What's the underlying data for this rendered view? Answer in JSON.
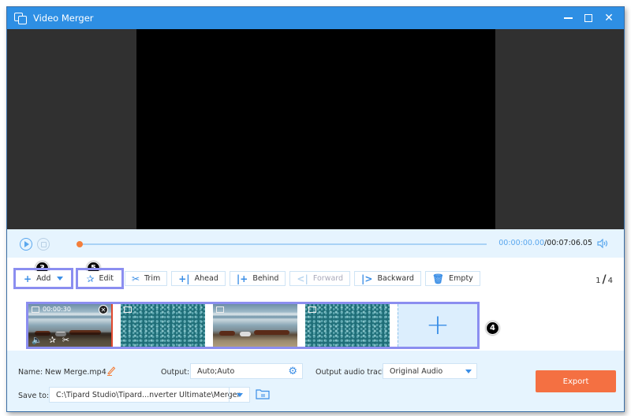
{
  "window": {
    "title": "Video Merger",
    "controls": {
      "minimize": "minimize",
      "maximize": "maximize",
      "close": "✕"
    }
  },
  "player": {
    "current_time": "00:00:00.00",
    "total_time": "/00:07:06.05",
    "progress_fraction": 0.0
  },
  "toolbar": {
    "add_label": "Add",
    "edit_label": "Edit",
    "trim_label": "Trim",
    "ahead_label": "Ahead",
    "behind_label": "Behind",
    "forward_label": "Forward",
    "backward_label": "Backward",
    "empty_label": "Empty",
    "icons": {
      "add": "+",
      "edit": "✰",
      "trim": "✂",
      "ahead": "+|",
      "behind": "|+",
      "forward": "<|",
      "backward": "|>",
      "empty": "🗑"
    }
  },
  "page_indicator": {
    "current": "1",
    "separator": "/",
    "total": "4"
  },
  "annotations": {
    "add": "3",
    "edit": "5",
    "clips": "4"
  },
  "clips": [
    {
      "type": "beach",
      "duration": "00:00:30",
      "selected": true
    },
    {
      "type": "noise",
      "duration": "",
      "selected": false
    },
    {
      "type": "beach",
      "duration": "",
      "selected": false
    },
    {
      "type": "noise",
      "duration": "",
      "selected": false
    }
  ],
  "add_slot_label": "+",
  "output": {
    "name_label": "Name:",
    "name_value": "New Merge.mp4",
    "output_label": "Output:",
    "output_value": "Auto;Auto",
    "audio_label": "Output audio track:",
    "audio_value": "Original Audio",
    "save_label": "Save to:",
    "save_value": "C:\\Tipard Studio\\Tipard...nverter Ultimate\\Merger",
    "export_label": "Export"
  },
  "colors": {
    "titlebar": "#2e8fe4",
    "accent": "#3a8ee6",
    "export": "#f47042",
    "highlight": "#8b8ef0",
    "progress_knob": "#f47e3a"
  }
}
